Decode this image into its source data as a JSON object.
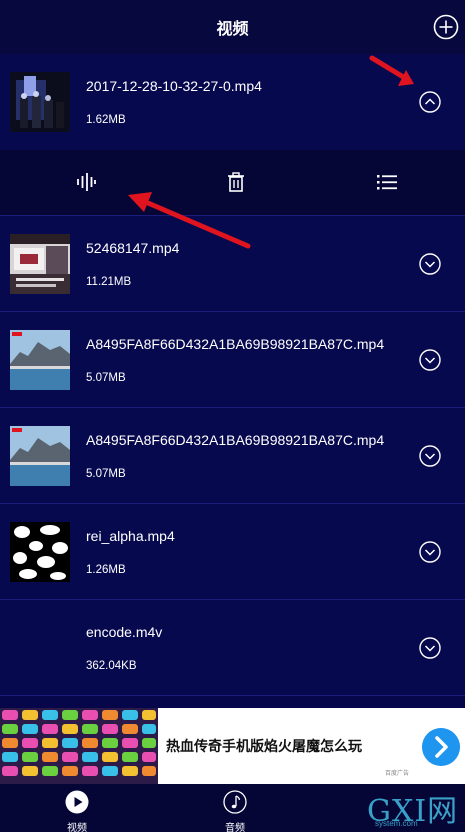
{
  "header": {
    "title": "视频"
  },
  "files": [
    {
      "name": "2017-12-28-10-32-27-0.mp4",
      "size": "1.62MB",
      "thumb": "dark-figures"
    },
    {
      "name": "52468147.mp4",
      "size": "11.21MB",
      "thumb": "poster"
    },
    {
      "name": "A8495FA8F66D432A1BA69B98921BA87C.mp4",
      "size": "5.07MB",
      "thumb": "mountain"
    },
    {
      "name": "A8495FA8F66D432A1BA69B98921BA87C.mp4",
      "size": "5.07MB",
      "thumb": "mountain"
    },
    {
      "name": "rei_alpha.mp4",
      "size": "1.26MB",
      "thumb": "alpha-blobs"
    },
    {
      "name": "encode.m4v",
      "size": "362.04KB",
      "thumb": "none"
    }
  ],
  "actions": {
    "audio_icon": "audio-wave-icon",
    "delete_icon": "trash-icon",
    "list_icon": "list-icon"
  },
  "ad": {
    "text": "热血传奇手机版焰火屠魔怎么玩",
    "small": "百度广告"
  },
  "nav": {
    "video_label": "视频",
    "audio_label": "音频"
  },
  "watermark": {
    "text": "GXI网",
    "small": "system.com"
  },
  "colors": {
    "background": "#06074a",
    "accent": "#1e96f0",
    "annotation": "#e0141e"
  }
}
